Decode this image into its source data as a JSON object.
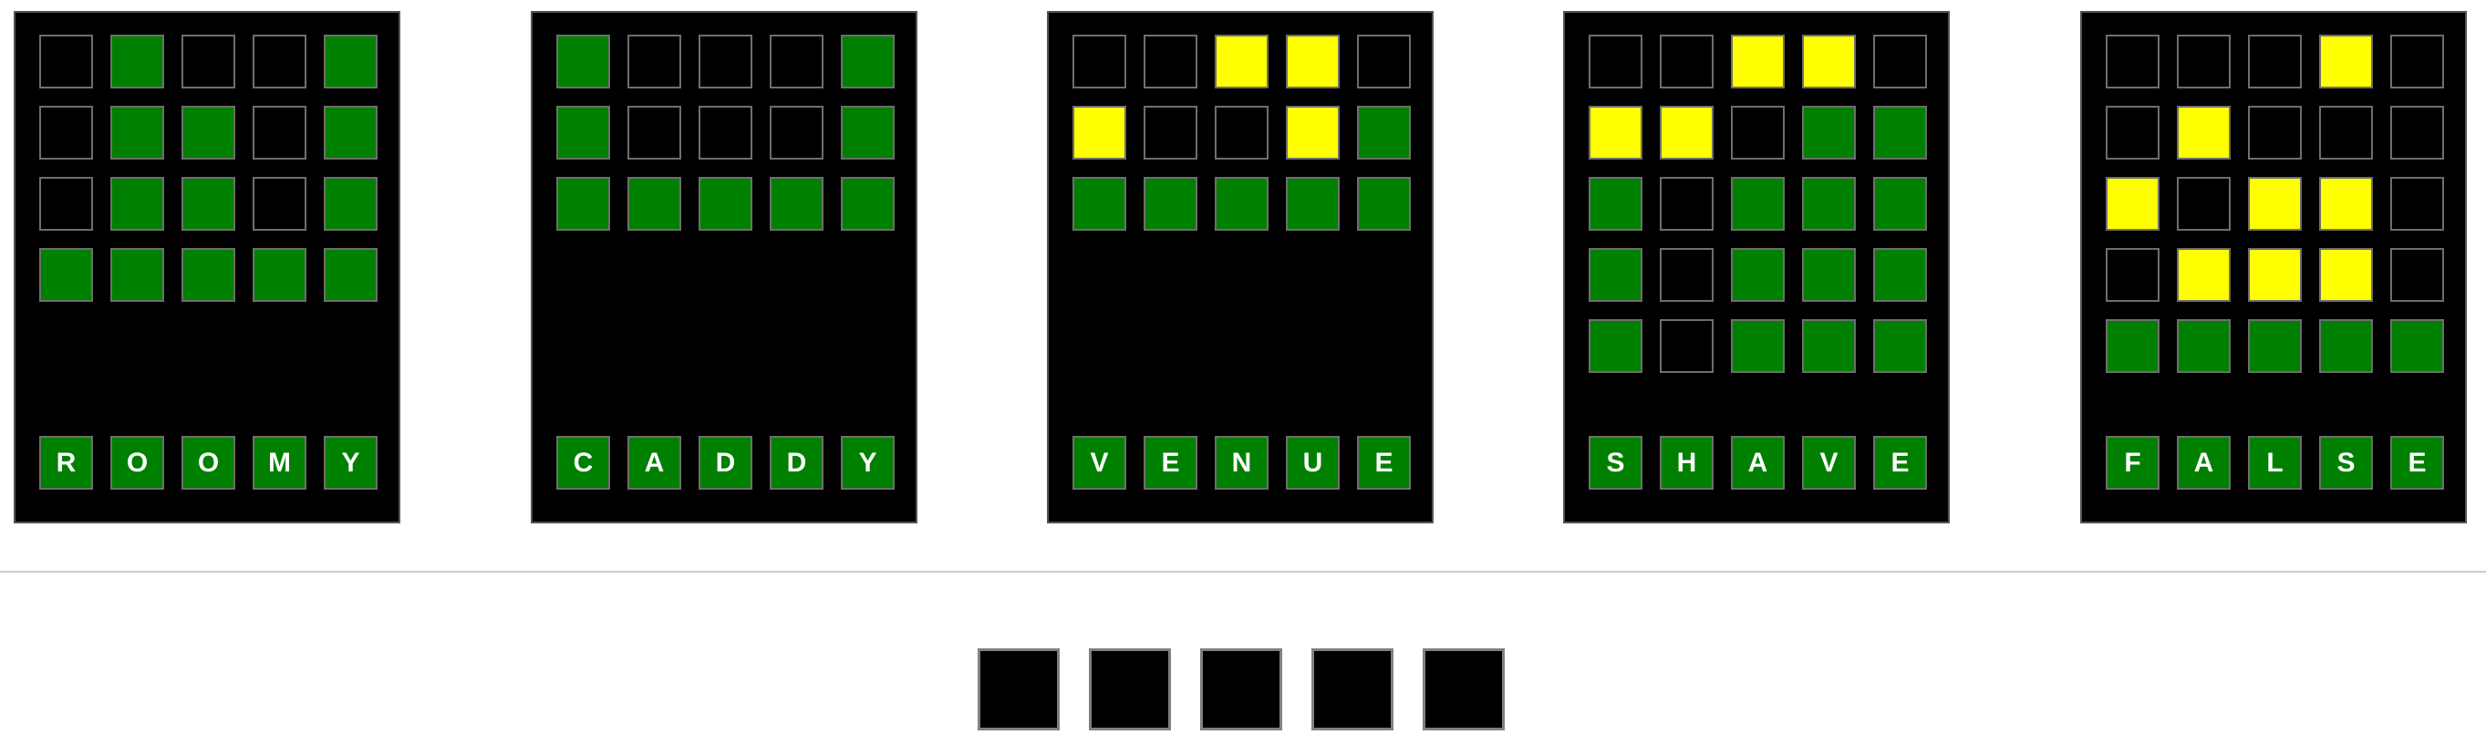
{
  "colors": {
    "green": "#008000",
    "yellow": "#ffff00",
    "empty": "#000000",
    "cell_border": "#6e6e6e",
    "board_background": "#000000"
  },
  "boards": [
    {
      "answer": [
        "R",
        "O",
        "O",
        "M",
        "Y"
      ],
      "guesses": [
        [
          "n",
          "g",
          "n",
          "n",
          "g"
        ],
        [
          "n",
          "g",
          "g",
          "n",
          "g"
        ],
        [
          "n",
          "g",
          "g",
          "n",
          "g"
        ],
        [
          "g",
          "g",
          "g",
          "g",
          "g"
        ]
      ]
    },
    {
      "answer": [
        "C",
        "A",
        "D",
        "D",
        "Y"
      ],
      "guesses": [
        [
          "g",
          "n",
          "n",
          "n",
          "g"
        ],
        [
          "g",
          "n",
          "n",
          "n",
          "g"
        ],
        [
          "g",
          "g",
          "g",
          "g",
          "g"
        ]
      ]
    },
    {
      "answer": [
        "V",
        "E",
        "N",
        "U",
        "E"
      ],
      "guesses": [
        [
          "n",
          "n",
          "y",
          "y",
          "n"
        ],
        [
          "y",
          "n",
          "n",
          "y",
          "g"
        ],
        [
          "g",
          "g",
          "g",
          "g",
          "g"
        ]
      ]
    },
    {
      "answer": [
        "S",
        "H",
        "A",
        "V",
        "E"
      ],
      "guesses": [
        [
          "n",
          "n",
          "y",
          "y",
          "n"
        ],
        [
          "y",
          "y",
          "n",
          "g",
          "g"
        ],
        [
          "g",
          "n",
          "g",
          "g",
          "g"
        ],
        [
          "g",
          "n",
          "g",
          "g",
          "g"
        ],
        [
          "g",
          "n",
          "g",
          "g",
          "g"
        ]
      ]
    },
    {
      "answer": [
        "F",
        "A",
        "L",
        "S",
        "E"
      ],
      "guesses": [
        [
          "n",
          "n",
          "n",
          "y",
          "n"
        ],
        [
          "n",
          "y",
          "n",
          "n",
          "n"
        ],
        [
          "y",
          "n",
          "y",
          "y",
          "n"
        ],
        [
          "n",
          "y",
          "y",
          "y",
          "n"
        ],
        [
          "g",
          "g",
          "g",
          "g",
          "g"
        ]
      ]
    }
  ],
  "input_row": [
    "",
    "",
    "",
    "",
    ""
  ]
}
